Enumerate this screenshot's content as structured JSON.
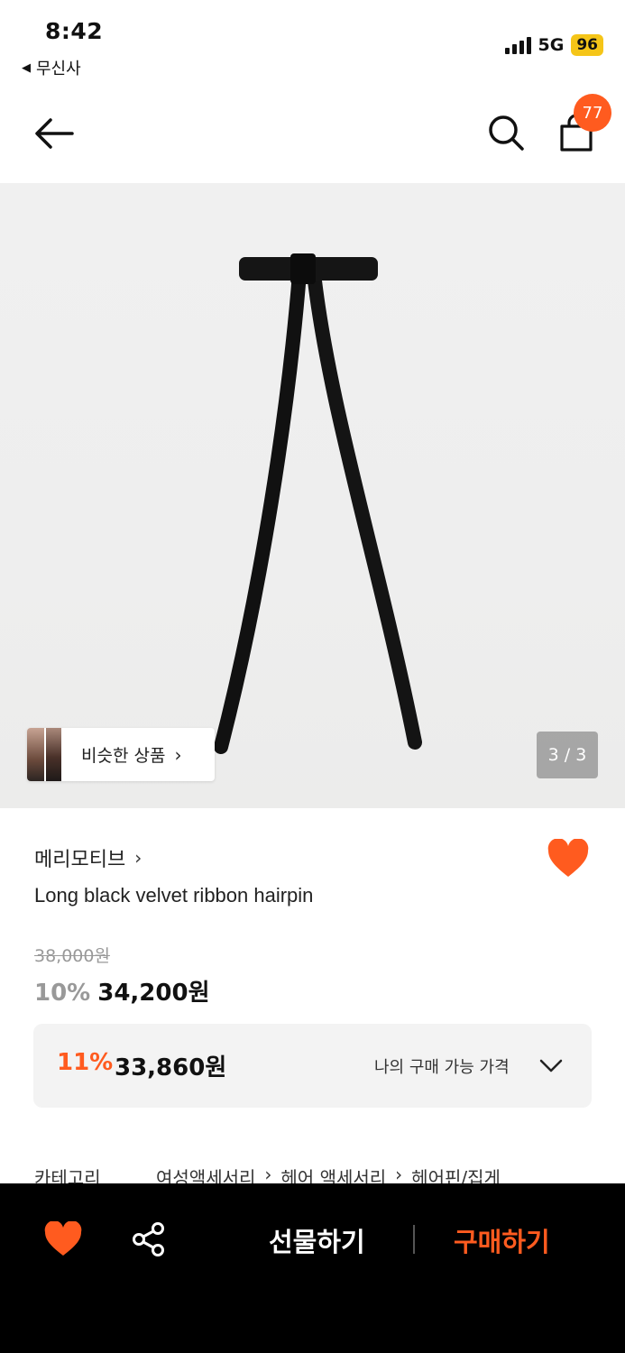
{
  "status_bar": {
    "time": "8:42",
    "back_app": "무신사",
    "network": "5G",
    "battery": "96"
  },
  "nav": {
    "cart_count": "77",
    "icons": [
      "back-arrow-icon",
      "search-icon",
      "shopping-bag-icon"
    ]
  },
  "gallery": {
    "similar_label": "비슷한 상품",
    "page_indicator": "3 / 3"
  },
  "product": {
    "brand": "메리모티브",
    "name": "Long black velvet ribbon hairpin",
    "original_price": "38,000원",
    "discount": "10%",
    "price": "34,200원",
    "my_price": {
      "discount": "11%",
      "price": "33,860원",
      "label": "나의 구매 가능 가격"
    },
    "category": {
      "label": "카테고리",
      "path": [
        "여성액세서리",
        "헤어 액세서리",
        "헤어핀/집게"
      ]
    }
  },
  "bottom_bar": {
    "gift_label": "선물하기",
    "buy_label": "구매하기"
  },
  "colors": {
    "accent": "#ff5b1f",
    "battery": "#f5c518",
    "bottom_bar": "#000000"
  }
}
